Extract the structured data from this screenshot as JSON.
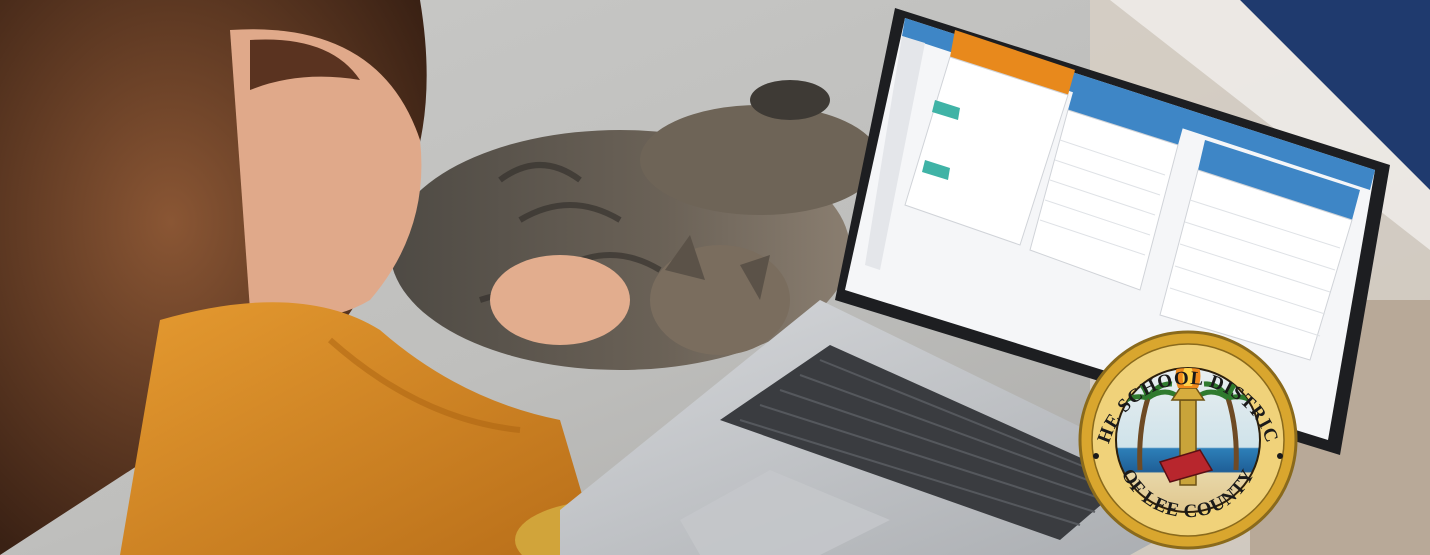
{
  "seal": {
    "top_text": "THE SCHOOL DISTRICT",
    "bottom_text": "OF LEE COUNTY"
  },
  "colors": {
    "navy": "#1f3a6e",
    "orange": "#e8891c",
    "ui_blue": "#3e86c6",
    "sweater": "#d98d28",
    "seal_gold": "#d9a62e"
  }
}
